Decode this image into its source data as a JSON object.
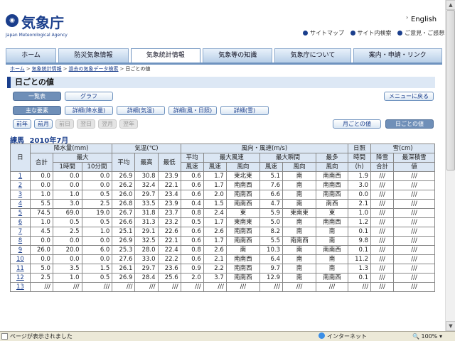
{
  "header": {
    "logo_mark": "jma",
    "logo_title": "気象庁",
    "logo_subtitle": "Japan Meteorological Agency",
    "english_link": "English",
    "util_links": [
      "サイトマップ",
      "サイト内検索",
      "ご意見・ご感想"
    ]
  },
  "nav": {
    "tabs": [
      "ホーム",
      "防災気象情報",
      "気象統計情報",
      "気象等の知識",
      "気象庁について",
      "案内・申請・リンク"
    ],
    "active_index": 2
  },
  "breadcrumb": [
    "ホーム",
    "気象統計情報",
    "過去の気象データ検索",
    "日ごとの値"
  ],
  "page_title": "日ごとの値",
  "view_buttons": {
    "table": "一覧表",
    "graph": "グラフ",
    "menu_back": "メニューに戻る"
  },
  "element_tabs": [
    "主な要素",
    "詳細(降水量)",
    "詳細(気温)",
    "詳細(風・日照)",
    "詳細(雪)"
  ],
  "period_nav": [
    "前年",
    "前月",
    "前日",
    "翌日",
    "翌月",
    "翌年"
  ],
  "period_type": {
    "monthly": "月ごとの値",
    "daily": "日ごとの値"
  },
  "station": "練馬",
  "period": "2010年7月",
  "table": {
    "h_day": "日",
    "h_precip": "降水量(mm)",
    "h_temp": "気温(℃)",
    "h_wind": "風向・風速(m/s)",
    "h_sun": "日照",
    "h_snow": "雪(cm)",
    "h_total": "合計",
    "h_max": "最大",
    "h_1h": "1時間",
    "h_10min": "10分間",
    "h_avg": "平均",
    "h_tmax": "最高",
    "h_tmin": "最低",
    "h_avg_ws": "平均",
    "h_ws": "風速",
    "h_max_wind": "最大風速",
    "h_max_gust": "最大瞬間",
    "h_most": "最多",
    "h_speed": "風速",
    "h_dir": "風向",
    "h_speed2": "風速",
    "h_dir2": "風向",
    "h_dir3": "風向",
    "h_sun_time": "時間",
    "h_sun_unit": "(h)",
    "h_snowfall": "降雪",
    "h_snowfall2": "合計",
    "h_depth": "最深積雪",
    "h_depth2": "値",
    "rows": [
      [
        "1",
        "0.0",
        "0.0",
        "0.0",
        "26.9",
        "30.8",
        "23.9",
        "0.6",
        "1.7",
        "東北東",
        "5.1",
        "南",
        "南南西",
        "1.9",
        "///",
        "///"
      ],
      [
        "2",
        "0.0",
        "0.0",
        "0.0",
        "26.2",
        "32.4",
        "22.1",
        "0.6",
        "1.7",
        "南南西",
        "7.6",
        "南",
        "南南西",
        "3.0",
        "///",
        "///"
      ],
      [
        "3",
        "1.0",
        "1.0",
        "0.5",
        "26.0",
        "29.7",
        "23.4",
        "0.6",
        "2.0",
        "南南西",
        "6.6",
        "南",
        "南南西",
        "0.0",
        "///",
        "///"
      ],
      [
        "4",
        "5.5",
        "3.0",
        "2.5",
        "26.8",
        "33.5",
        "23.9",
        "0.4",
        "1.5",
        "南南西",
        "4.7",
        "南",
        "南西",
        "2.1",
        "///",
        "///"
      ],
      [
        "5",
        "74.5",
        "69.0",
        "19.0",
        "26.7",
        "31.8",
        "23.7",
        "0.8",
        "2.4",
        "東",
        "5.9",
        "東南東",
        "東",
        "1.0",
        "///",
        "///"
      ],
      [
        "6",
        "1.0",
        "0.5",
        "0.5",
        "26.6",
        "31.3",
        "23.2",
        "0.5",
        "1.7",
        "東南東",
        "5.0",
        "南",
        "南南西",
        "1.2",
        "///",
        "///"
      ],
      [
        "7",
        "4.5",
        "2.5",
        "1.0",
        "25.1",
        "29.1",
        "22.6",
        "0.6",
        "2.6",
        "南南西",
        "8.2",
        "南",
        "南",
        "0.1",
        "///",
        "///"
      ],
      [
        "8",
        "0.0",
        "0.0",
        "0.0",
        "26.9",
        "32.5",
        "22.1",
        "0.6",
        "1.7",
        "南南西",
        "5.5",
        "南南西",
        "南",
        "9.8",
        "///",
        "///"
      ],
      [
        "9",
        "26.0",
        "20.0",
        "6.0",
        "25.3",
        "28.0",
        "22.4",
        "0.8",
        "2.6",
        "南",
        "10.3",
        "南",
        "南南西",
        "0.1",
        "///",
        "///"
      ],
      [
        "10",
        "0.0",
        "0.0",
        "0.0",
        "27.6",
        "33.0",
        "22.2",
        "0.6",
        "2.1",
        "南南西",
        "6.4",
        "南",
        "南",
        "11.2",
        "///",
        "///"
      ],
      [
        "11",
        "5.0",
        "3.5",
        "1.5",
        "26.1",
        "29.7",
        "23.6",
        "0.9",
        "2.2",
        "南南西",
        "9.7",
        "南",
        "南",
        "1.3",
        "///",
        "///"
      ],
      [
        "12",
        "2.5",
        "1.0",
        "0.5",
        "26.9",
        "28.4",
        "25.6",
        "2.0",
        "3.7",
        "南南西",
        "12.9",
        "南",
        "南南西",
        "0.1",
        "///",
        "///"
      ],
      [
        "13",
        "///",
        "///",
        "///",
        "///",
        "///",
        "///",
        "///",
        "///",
        "///",
        "///",
        "///",
        "///",
        "///",
        "///",
        "///"
      ]
    ]
  },
  "statusbar": {
    "text": "ページが表示されました",
    "zone": "インターネット",
    "zoom": "100%"
  }
}
